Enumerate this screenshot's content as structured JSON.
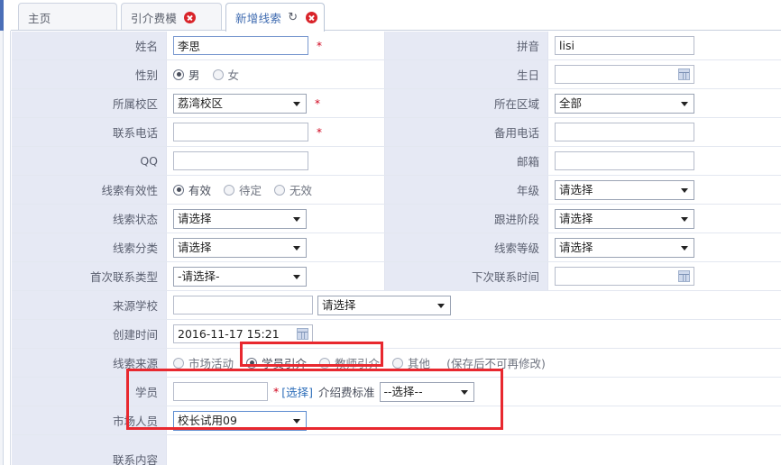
{
  "tabs": [
    {
      "label": "主页",
      "closable": false,
      "refreshable": false,
      "active": false
    },
    {
      "label": "引介费模",
      "closable": true,
      "refreshable": false,
      "active": false
    },
    {
      "label": "新增线索",
      "closable": true,
      "refreshable": true,
      "active": true
    }
  ],
  "icons": {
    "close": "close-icon",
    "refresh": "refresh-icon",
    "calendar": "calendar-icon",
    "dropdown": "chevron-down-icon"
  },
  "colors": {
    "accent": "#4b6fb8",
    "label_bg": "#e6e9f4",
    "required": "#d0021b",
    "highlight": "#e8282f",
    "link": "#2f6fba",
    "active_tab_text": "#3f6bb0"
  },
  "form": {
    "name": {
      "label": "姓名",
      "value": "李思",
      "required": true
    },
    "pinyin": {
      "label": "拼音",
      "value": "lisi",
      "required": false
    },
    "gender": {
      "label": "性别",
      "options": [
        {
          "label": "男",
          "selected": true
        },
        {
          "label": "女",
          "selected": false
        }
      ]
    },
    "birthday": {
      "label": "生日",
      "value": "",
      "required": false
    },
    "campus": {
      "label": "所属校区",
      "value": "荔湾校区",
      "required": true
    },
    "region": {
      "label": "所在区域",
      "value": "全部",
      "required": false
    },
    "phone": {
      "label": "联系电话",
      "value": "",
      "required": true
    },
    "backup_phone": {
      "label": "备用电话",
      "value": "",
      "required": false
    },
    "qq": {
      "label": "QQ",
      "value": "",
      "required": false
    },
    "email": {
      "label": "邮箱",
      "value": "",
      "required": false
    },
    "validity": {
      "label": "线索有效性",
      "options": [
        {
          "label": "有效",
          "selected": true
        },
        {
          "label": "待定",
          "selected": false
        },
        {
          "label": "无效",
          "selected": false
        }
      ]
    },
    "grade": {
      "label": "年级",
      "value": "请选择"
    },
    "status": {
      "label": "线索状态",
      "value": "请选择"
    },
    "follow_stage": {
      "label": "跟进阶段",
      "value": "请选择"
    },
    "category": {
      "label": "线索分类",
      "value": "请选择"
    },
    "level": {
      "label": "线索等级",
      "value": "请选择"
    },
    "first_contact_type": {
      "label": "首次联系类型",
      "value": "-请选择-"
    },
    "next_contact_time": {
      "label": "下次联系时间",
      "value": ""
    },
    "source_school": {
      "label": "来源学校",
      "value": "",
      "select_value": "请选择"
    },
    "create_time": {
      "label": "创建时间",
      "value": "2016-11-17 15:21"
    },
    "lead_source": {
      "label": "线索来源",
      "note": "(保存后不可再修改)",
      "options": [
        {
          "label": "市场活动",
          "selected": false
        },
        {
          "label": "学员引介",
          "selected": true
        },
        {
          "label": "教师引介",
          "selected": false
        },
        {
          "label": "其他",
          "selected": false
        }
      ]
    },
    "student": {
      "label": "学员",
      "value": "",
      "required": true,
      "pick_link": "[选择]",
      "fee_label": "介绍费标准",
      "fee_value": "--选择--"
    },
    "market_staff": {
      "label": "市场人员",
      "value": "校长试用09"
    },
    "contact_content": {
      "label": "联系内容",
      "value": ""
    }
  }
}
